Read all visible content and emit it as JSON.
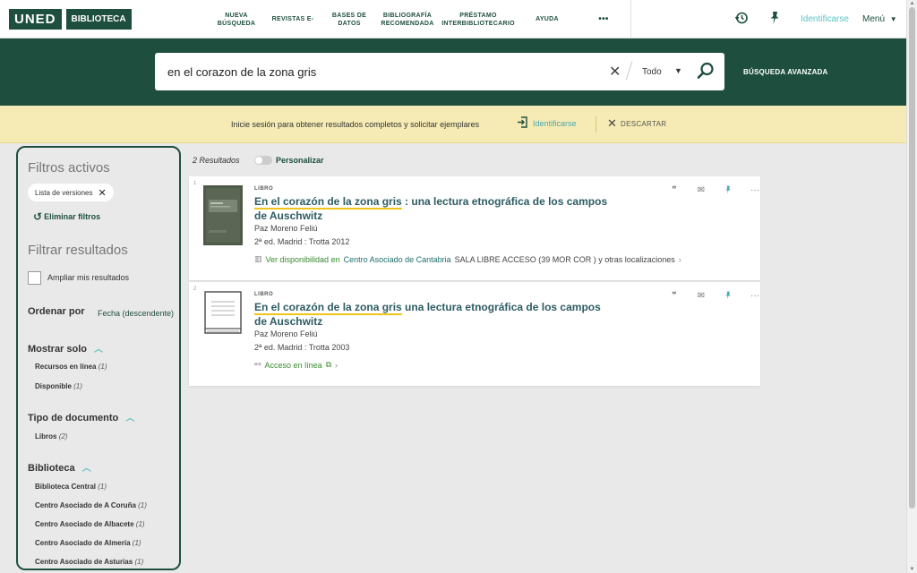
{
  "header": {
    "logo_uned": "UNED",
    "logo_biblioteca": "BIBLIOTECA",
    "nav": [
      {
        "line1": "NUEVA",
        "line2": "BÚSQUEDA"
      },
      {
        "line1": "REVISTAS E-",
        "line2": ""
      },
      {
        "line1": "BASES DE",
        "line2": "DATOS"
      },
      {
        "line1": "BIBLIOGRAFÍA",
        "line2": "RECOMENDADA"
      },
      {
        "line1": "PRÉSTAMO",
        "line2": "INTERBIBLIOTECARIO"
      },
      {
        "line1": "AYUDA",
        "line2": ""
      }
    ],
    "more": "•••",
    "login": "Identificarse",
    "menu": "Menú"
  },
  "search": {
    "query": "en el corazon de la zona gris",
    "scope": "Todo",
    "advanced": "BÚSQUEDA AVANZADA"
  },
  "banner": {
    "message": "Inicie sesión para obtener resultados completos y solicitar ejemplares",
    "login": "Identificarse",
    "dismiss": "DESCARTAR"
  },
  "sidebar": {
    "active_title": "Filtros activos",
    "active_chip": "Lista de versiones",
    "clear": "Eliminar filtros",
    "filter_title": "Filtrar resultados",
    "expand_label": "Ampliar mis resultados",
    "sort_label": "Ordenar por",
    "sort_value": "Fecha (descendente)",
    "show_only": {
      "title": "Mostrar solo",
      "items": [
        {
          "label": "Recursos en línea",
          "count": "(1)"
        },
        {
          "label": "Disponible",
          "count": "(1)"
        }
      ]
    },
    "doc_type": {
      "title": "Tipo de documento",
      "items": [
        {
          "label": "Libros",
          "count": "(2)"
        }
      ]
    },
    "library": {
      "title": "Biblioteca",
      "items": [
        {
          "label": "Biblioteca Central",
          "count": "(1)"
        },
        {
          "label": "Centro Asociado de A Coruña",
          "count": "(1)"
        },
        {
          "label": "Centro Asociado de Albacete",
          "count": "(1)"
        },
        {
          "label": "Centro Asociado de Almería",
          "count": "(1)"
        },
        {
          "label": "Centro Asociado de Asturias",
          "count": "(1)"
        }
      ]
    }
  },
  "results": {
    "count": "2 Resultados",
    "personalize": "Personalizar",
    "items": [
      {
        "num": "1",
        "type": "LIBRO",
        "title_hl": "En el corazón de la zona gris",
        "title_rest": " : una lectura etnográfica de los campos de Auschwitz",
        "author": "Paz Moreno Feliú",
        "edition": "2ª ed. Madrid : Trotta 2012",
        "avail_label": "Ver disponibilidad en",
        "avail_location": "Centro Asociado de Cantabria",
        "avail_rest": "SALA LIBRE ACCESO (39 MOR COR ) y otras localizaciones"
      },
      {
        "num": "2",
        "type": "LIBRO",
        "title_hl": "En el corazón de la zona gris",
        "title_rest": " una lectura etnográfica de los campos de Auschwitz",
        "author": "Paz Moreno Feliú",
        "edition": "2ª ed. Madrid : Trotta 2003",
        "online": "Acceso en línea"
      }
    ]
  }
}
